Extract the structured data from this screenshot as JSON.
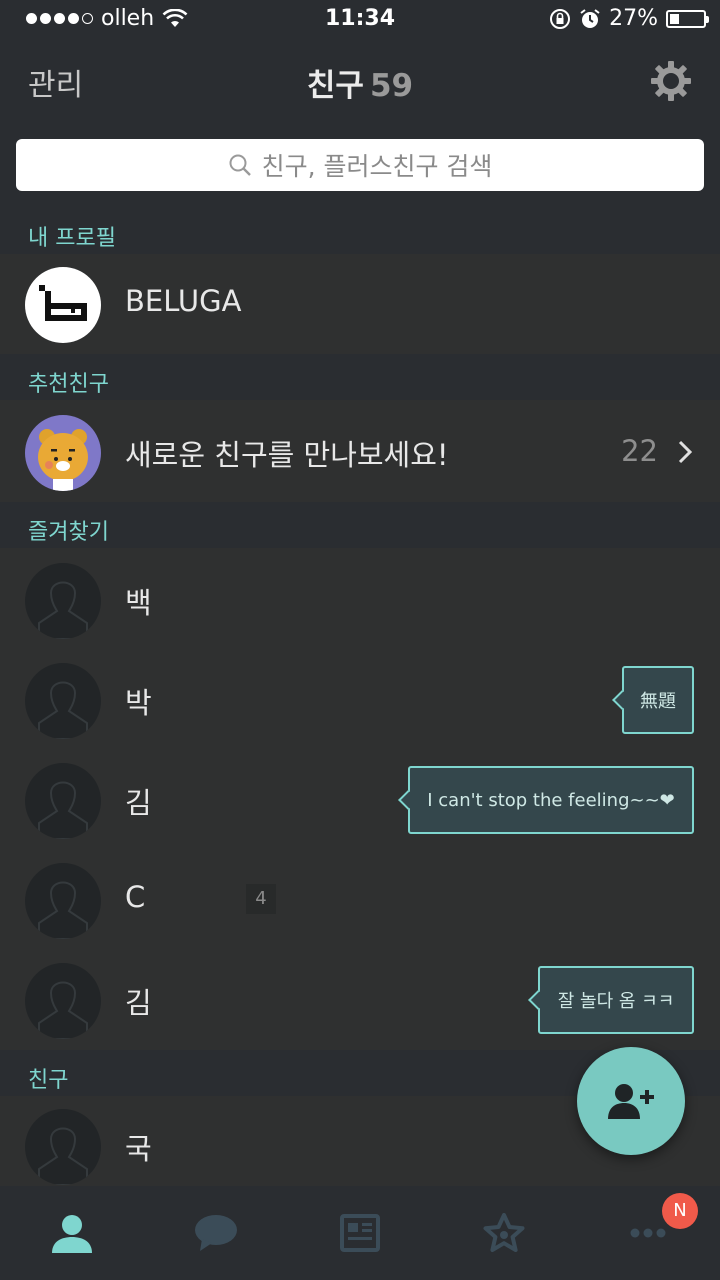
{
  "status_bar": {
    "carrier": "olleh",
    "time": "11:34",
    "battery": "27%",
    "battery_level": 0.27
  },
  "nav": {
    "left": "관리",
    "title": "친구",
    "count": "59"
  },
  "search": {
    "placeholder": "친구, 플러스친구 검색"
  },
  "sections": {
    "profile": "내 프로필",
    "recommend": "추천친구",
    "favorites": "즐겨찾기",
    "friends": "친구"
  },
  "profile": {
    "name": "BELUGA"
  },
  "recommend": {
    "text": "새로운 친구를 만나보세요!",
    "count": "22"
  },
  "favorites": [
    {
      "name": "백"
    },
    {
      "name": "박",
      "status": "無題"
    },
    {
      "name": "김",
      "status": "I can't stop the feeling~~❤"
    },
    {
      "name": "C",
      "badge": "4"
    },
    {
      "name": "김",
      "status": "잘 놀다 옴 ㅋㅋ"
    }
  ],
  "friends": [
    {
      "name": "국"
    }
  ],
  "tab_bar": {
    "icons": [
      "friends-icon",
      "chat-icon",
      "news-icon",
      "star-icon",
      "more-icon"
    ],
    "badge": "N",
    "active_color": "#7fd6cf",
    "inactive_color": "#3b4c58"
  },
  "colors": {
    "accent": "#7fd6cf",
    "badge": "#f05a4a",
    "background": "#2f3030",
    "header": "#2a2d31"
  }
}
